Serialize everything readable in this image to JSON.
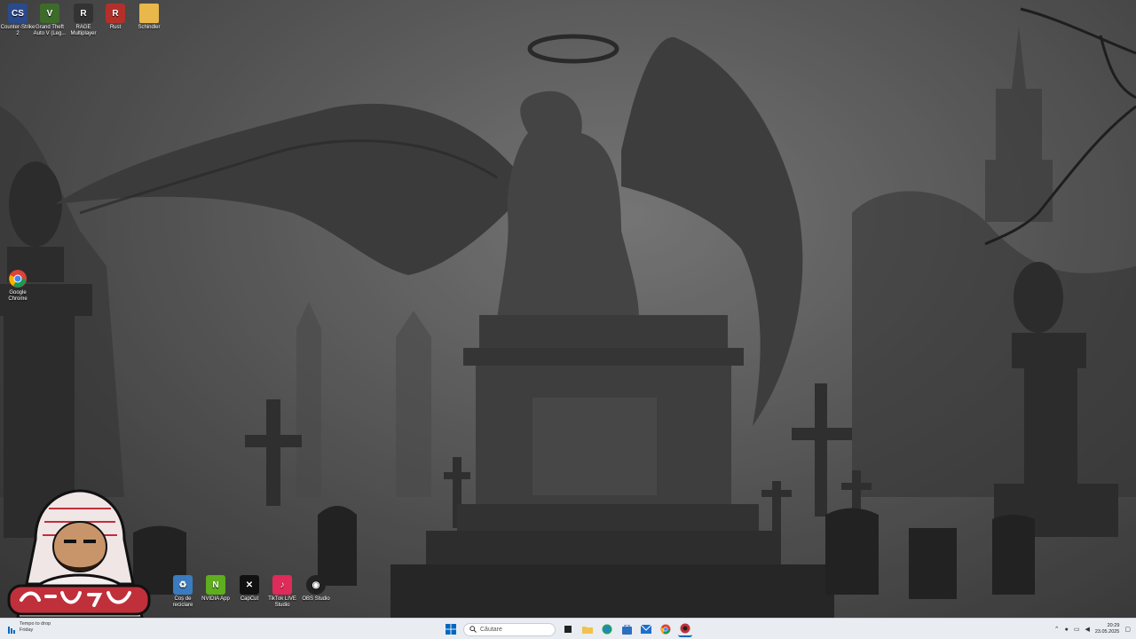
{
  "desktop": {
    "icons": [
      {
        "label": "Counter-Strike 2",
        "glyph": "CS",
        "color": "#2a4a8c"
      },
      {
        "label": "Grand Theft Auto V (Leg...",
        "glyph": "V",
        "color": "#3d6b2a"
      },
      {
        "label": "RAGE Multiplayer",
        "glyph": "R",
        "color": "#333"
      },
      {
        "label": "Rust",
        "glyph": "R",
        "color": "#b3302a"
      },
      {
        "label": "Schindler",
        "glyph": "",
        "color": "#e8b84a"
      }
    ],
    "chrome": {
      "label": "Google Chrome"
    },
    "bottom_icons": [
      {
        "label": "Coș de reciclare",
        "glyph": "♻",
        "color": "#3b7bbf"
      },
      {
        "label": "NVIDIA App",
        "glyph": "N",
        "color": "#5fae1e"
      },
      {
        "label": "CapCut",
        "glyph": "✕",
        "color": "#111"
      },
      {
        "label": "TikTok LIVE Studio",
        "glyph": "♪",
        "color": "#e02a5a"
      },
      {
        "label": "OBS Studio",
        "glyph": "◉",
        "color": "#222"
      }
    ]
  },
  "taskbar": {
    "weather_line1": "Tempo to drop",
    "weather_line2": "Friday",
    "search_placeholder": "Căutare",
    "time": "20:29",
    "date": "23.05.2025",
    "accent": "#0067c0"
  }
}
